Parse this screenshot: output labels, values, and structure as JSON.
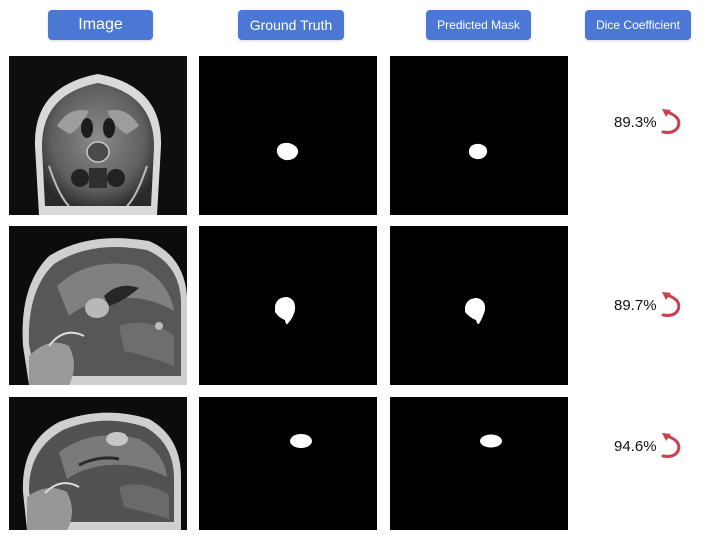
{
  "headers": {
    "image": "Image",
    "ground_truth": "Ground Truth",
    "predicted_mask": "Predicted Mask",
    "dice_coefficient": "Dice Coefficient"
  },
  "rows": [
    {
      "view": "coronal",
      "dice": "89.3%"
    },
    {
      "view": "sagittal",
      "dice": "89.7%"
    },
    {
      "view": "sagittal",
      "dice": "94.6%"
    }
  ],
  "colors": {
    "header_bg": "#4a78d4",
    "header_text": "#ffffff",
    "mask_bg": "#000000",
    "mask_fg": "#ffffff",
    "arrow": "#c9404f"
  }
}
